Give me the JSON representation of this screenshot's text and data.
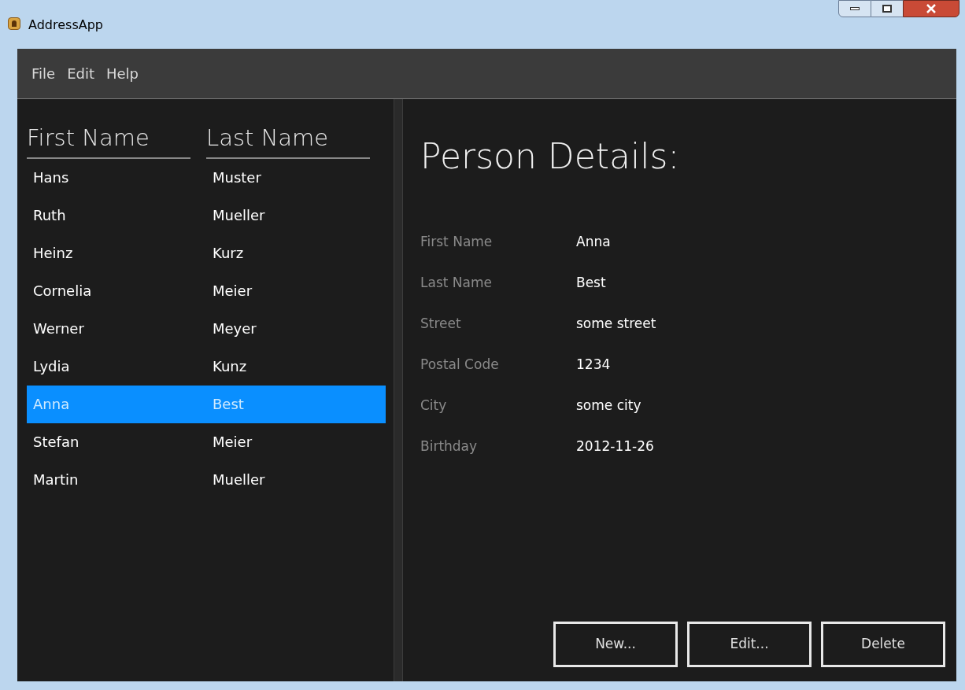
{
  "window": {
    "title": "AddressApp"
  },
  "menu": [
    "File",
    "Edit",
    "Help"
  ],
  "table": {
    "columns": [
      "First Name",
      "Last Name"
    ],
    "rows": [
      {
        "first": "Hans",
        "last": "Muster",
        "selected": false
      },
      {
        "first": "Ruth",
        "last": "Mueller",
        "selected": false
      },
      {
        "first": "Heinz",
        "last": "Kurz",
        "selected": false
      },
      {
        "first": "Cornelia",
        "last": "Meier",
        "selected": false
      },
      {
        "first": "Werner",
        "last": "Meyer",
        "selected": false
      },
      {
        "first": "Lydia",
        "last": "Kunz",
        "selected": false
      },
      {
        "first": "Anna",
        "last": "Best",
        "selected": true
      },
      {
        "first": "Stefan",
        "last": "Meier",
        "selected": false
      },
      {
        "first": "Martin",
        "last": "Mueller",
        "selected": false
      }
    ]
  },
  "details": {
    "title": "Person Details:",
    "fields": [
      {
        "label": "First Name",
        "value": "Anna"
      },
      {
        "label": "Last Name",
        "value": "Best"
      },
      {
        "label": "Street",
        "value": "some street"
      },
      {
        "label": "Postal Code",
        "value": "1234"
      },
      {
        "label": "City",
        "value": "some city"
      },
      {
        "label": "Birthday",
        "value": "2012-11-26"
      }
    ]
  },
  "buttons": [
    "New...",
    "Edit...",
    "Delete"
  ]
}
